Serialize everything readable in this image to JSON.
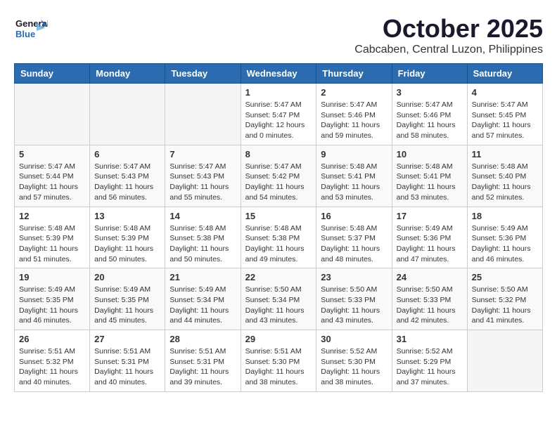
{
  "header": {
    "logo": {
      "general": "General",
      "blue": "Blue"
    },
    "title": "October 2025",
    "location": "Cabcaben, Central Luzon, Philippines"
  },
  "days_of_week": [
    "Sunday",
    "Monday",
    "Tuesday",
    "Wednesday",
    "Thursday",
    "Friday",
    "Saturday"
  ],
  "weeks": [
    [
      {
        "day": "",
        "info": ""
      },
      {
        "day": "",
        "info": ""
      },
      {
        "day": "",
        "info": ""
      },
      {
        "day": "1",
        "sunrise": "5:47 AM",
        "sunset": "5:47 PM",
        "daylight": "12 hours and 0 minutes."
      },
      {
        "day": "2",
        "sunrise": "5:47 AM",
        "sunset": "5:46 PM",
        "daylight": "11 hours and 59 minutes."
      },
      {
        "day": "3",
        "sunrise": "5:47 AM",
        "sunset": "5:46 PM",
        "daylight": "11 hours and 58 minutes."
      },
      {
        "day": "4",
        "sunrise": "5:47 AM",
        "sunset": "5:45 PM",
        "daylight": "11 hours and 57 minutes."
      }
    ],
    [
      {
        "day": "5",
        "sunrise": "5:47 AM",
        "sunset": "5:44 PM",
        "daylight": "11 hours and 57 minutes."
      },
      {
        "day": "6",
        "sunrise": "5:47 AM",
        "sunset": "5:43 PM",
        "daylight": "11 hours and 56 minutes."
      },
      {
        "day": "7",
        "sunrise": "5:47 AM",
        "sunset": "5:43 PM",
        "daylight": "11 hours and 55 minutes."
      },
      {
        "day": "8",
        "sunrise": "5:47 AM",
        "sunset": "5:42 PM",
        "daylight": "11 hours and 54 minutes."
      },
      {
        "day": "9",
        "sunrise": "5:48 AM",
        "sunset": "5:41 PM",
        "daylight": "11 hours and 53 minutes."
      },
      {
        "day": "10",
        "sunrise": "5:48 AM",
        "sunset": "5:41 PM",
        "daylight": "11 hours and 53 minutes."
      },
      {
        "day": "11",
        "sunrise": "5:48 AM",
        "sunset": "5:40 PM",
        "daylight": "11 hours and 52 minutes."
      }
    ],
    [
      {
        "day": "12",
        "sunrise": "5:48 AM",
        "sunset": "5:39 PM",
        "daylight": "11 hours and 51 minutes."
      },
      {
        "day": "13",
        "sunrise": "5:48 AM",
        "sunset": "5:39 PM",
        "daylight": "11 hours and 50 minutes."
      },
      {
        "day": "14",
        "sunrise": "5:48 AM",
        "sunset": "5:38 PM",
        "daylight": "11 hours and 50 minutes."
      },
      {
        "day": "15",
        "sunrise": "5:48 AM",
        "sunset": "5:38 PM",
        "daylight": "11 hours and 49 minutes."
      },
      {
        "day": "16",
        "sunrise": "5:48 AM",
        "sunset": "5:37 PM",
        "daylight": "11 hours and 48 minutes."
      },
      {
        "day": "17",
        "sunrise": "5:49 AM",
        "sunset": "5:36 PM",
        "daylight": "11 hours and 47 minutes."
      },
      {
        "day": "18",
        "sunrise": "5:49 AM",
        "sunset": "5:36 PM",
        "daylight": "11 hours and 46 minutes."
      }
    ],
    [
      {
        "day": "19",
        "sunrise": "5:49 AM",
        "sunset": "5:35 PM",
        "daylight": "11 hours and 46 minutes."
      },
      {
        "day": "20",
        "sunrise": "5:49 AM",
        "sunset": "5:35 PM",
        "daylight": "11 hours and 45 minutes."
      },
      {
        "day": "21",
        "sunrise": "5:49 AM",
        "sunset": "5:34 PM",
        "daylight": "11 hours and 44 minutes."
      },
      {
        "day": "22",
        "sunrise": "5:50 AM",
        "sunset": "5:34 PM",
        "daylight": "11 hours and 43 minutes."
      },
      {
        "day": "23",
        "sunrise": "5:50 AM",
        "sunset": "5:33 PM",
        "daylight": "11 hours and 43 minutes."
      },
      {
        "day": "24",
        "sunrise": "5:50 AM",
        "sunset": "5:33 PM",
        "daylight": "11 hours and 42 minutes."
      },
      {
        "day": "25",
        "sunrise": "5:50 AM",
        "sunset": "5:32 PM",
        "daylight": "11 hours and 41 minutes."
      }
    ],
    [
      {
        "day": "26",
        "sunrise": "5:51 AM",
        "sunset": "5:32 PM",
        "daylight": "11 hours and 40 minutes."
      },
      {
        "day": "27",
        "sunrise": "5:51 AM",
        "sunset": "5:31 PM",
        "daylight": "11 hours and 40 minutes."
      },
      {
        "day": "28",
        "sunrise": "5:51 AM",
        "sunset": "5:31 PM",
        "daylight": "11 hours and 39 minutes."
      },
      {
        "day": "29",
        "sunrise": "5:51 AM",
        "sunset": "5:30 PM",
        "daylight": "11 hours and 38 minutes."
      },
      {
        "day": "30",
        "sunrise": "5:52 AM",
        "sunset": "5:30 PM",
        "daylight": "11 hours and 38 minutes."
      },
      {
        "day": "31",
        "sunrise": "5:52 AM",
        "sunset": "5:29 PM",
        "daylight": "11 hours and 37 minutes."
      },
      {
        "day": "",
        "info": ""
      }
    ]
  ],
  "labels": {
    "sunrise": "Sunrise:",
    "sunset": "Sunset:",
    "daylight": "Daylight:"
  }
}
